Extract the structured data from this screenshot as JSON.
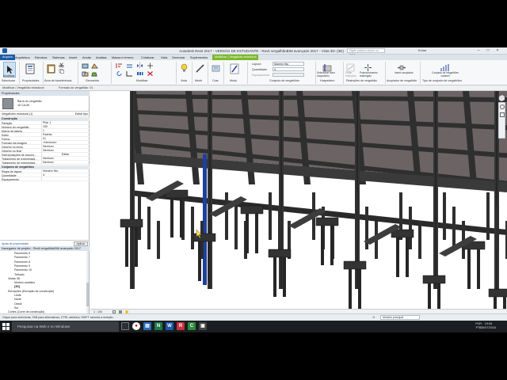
{
  "window": {
    "title": "Autodesk Revit 2017 - VERSÃO DE ESTUDANTE - Revit vergalhãoBIM avançado 2017 - Vista 3D: {3D}",
    "search_placeholder": "Digite palavra-chave ou frase",
    "user": "Entrar"
  },
  "tabs": [
    "Arquivo",
    "Arquitetura",
    "Estrutura",
    "Sistemas",
    "Inserir",
    "Anotar",
    "Analisar",
    "Massa e terreno",
    "Colaborar",
    "Vista",
    "Gerenciar",
    "Suplementos",
    "Modificar | Vergalhão estrutural"
  ],
  "ribbon": {
    "panels": [
      "Selecionar",
      "Propriedades",
      "Área de transferência",
      "Geometria",
      "Modificar",
      "Vista",
      "Medir",
      "Criar",
      "Modo",
      "Conjunto de vergalhões",
      "Hospedeiro",
      "Restrições de vergalhão",
      "Acoplador de vergalhão",
      "Tipo de conjunto de vergalhões"
    ],
    "buttons": {
      "modify": "Modificar",
      "properties": "Propriedades",
      "layout_label": "Layout:",
      "layout_value": "Número fixo",
      "quantity_label": "Quantidade:",
      "quantity_value": "4",
      "spacing_label": "Espaçamento:",
      "edit_constraints": "Editar restrições",
      "select_new_host": "Selecionar novo hospedeiro",
      "reposition": "Posicionamento restringido",
      "insert_coupler": "Inserir acoplador",
      "varying_set": "Conjunto de vergalhões variável"
    }
  },
  "options_bar": {
    "left": "Modificar | Vergalhão estrutural",
    "mid": "Formato do vergalhão: 01"
  },
  "properties": {
    "header": "Propriedades",
    "type_name": "Barra do vergalhão",
    "type_sub": "16 CA-50",
    "instance_selector": "Vergalhões estrutural (1)",
    "edit_type": "Editar tipo",
    "groups": {
      "construction": "Construção",
      "rebar_set": "Conjunto de vergalhões"
    },
    "rows": [
      {
        "k": "Partição",
        "v": "Pilar 1"
      },
      {
        "k": "Número do vergalhão",
        "v": "150"
      },
      {
        "k": "Marca da tabela",
        "v": "1"
      },
      {
        "k": "Estilo",
        "v": "Padrão"
      },
      {
        "k": "Forma",
        "v": "01"
      },
      {
        "k": "Formato da imagem",
        "v": "<Nenhum>"
      },
      {
        "k": "Gancho no início",
        "v": "Nenhum"
      },
      {
        "k": "Gancho no final",
        "v": "Nenhum"
      },
      {
        "k": "Sobreposições de ancora…",
        "v": "Editar"
      },
      {
        "k": "Tratamento de extremidad…",
        "v": "Nenhum"
      },
      {
        "k": "Tratamento de extremidad…",
        "v": "Nenhum"
      }
    ],
    "set_rows": [
      {
        "k": "Regra de layout",
        "v": "Número fixo"
      },
      {
        "k": "Quantidade",
        "v": "4"
      },
      {
        "k": "Espaçamento",
        "v": ""
      }
    ],
    "help_link": "Ajuda de propriedades",
    "apply": "Aplicar"
  },
  "browser": {
    "header": "Navegador de projeto - Revit vergalhãoBIM avançado 2017",
    "items": [
      {
        "label": "Pavimento 6",
        "indent": 16
      },
      {
        "label": "Pavimento 7",
        "indent": 16
      },
      {
        "label": "Pavimento 8",
        "indent": 16
      },
      {
        "label": "Pavimento 9",
        "indent": 16
      },
      {
        "label": "Pavimento 10",
        "indent": 16
      },
      {
        "label": "Telhado",
        "indent": 16
      },
      {
        "label": "Vistas 3D",
        "indent": 8
      },
      {
        "label": "Modelo analítico",
        "indent": 16
      },
      {
        "label": "{3D}",
        "indent": 16,
        "bold": true
      },
      {
        "label": "Elevações (Elevação de construção)",
        "indent": 8
      },
      {
        "label": "Leste",
        "indent": 16
      },
      {
        "label": "Norte",
        "indent": 16
      },
      {
        "label": "Oeste",
        "indent": 16
      },
      {
        "label": "Sul",
        "indent": 16
      },
      {
        "label": "Cortes (Corte de construção)",
        "indent": 8
      },
      {
        "label": "Legendas",
        "indent": 4
      },
      {
        "label": "Tabelas/Quantidades",
        "indent": 4
      },
      {
        "label": "Levantamento de material de pilar estrutural",
        "indent": 12
      },
      {
        "label": "Tabela de vergalhões",
        "indent": 12,
        "selected": true
      },
      {
        "label": "Folhas (todas)",
        "indent": 4
      },
      {
        "label": "Famílias",
        "indent": 4
      },
      {
        "label": "Grupos",
        "indent": 4
      },
      {
        "label": "Vínculos do Revit",
        "indent": 4
      }
    ]
  },
  "viewcontrol": {
    "scale": "1 : 100"
  },
  "status": {
    "hint": "Clique para selecionar, TAB para alternativas, CTRL adiciona, SHIFT cancela a seleção.",
    "model": "Modelo principal",
    "zero": ":0"
  },
  "taskbar": {
    "search_placeholder": "Pesquisar na Web e no Windows",
    "lang1": "POR",
    "lang2": "PTB",
    "time": "19:06",
    "date": "26/07/2016"
  },
  "colors": {
    "ribbon_accent": "#7ab929",
    "file_tab": "#1b5aa8",
    "selected_rebar": "#1d3f9e",
    "slab": "#6b6364",
    "beam": "#2f2f2f"
  }
}
